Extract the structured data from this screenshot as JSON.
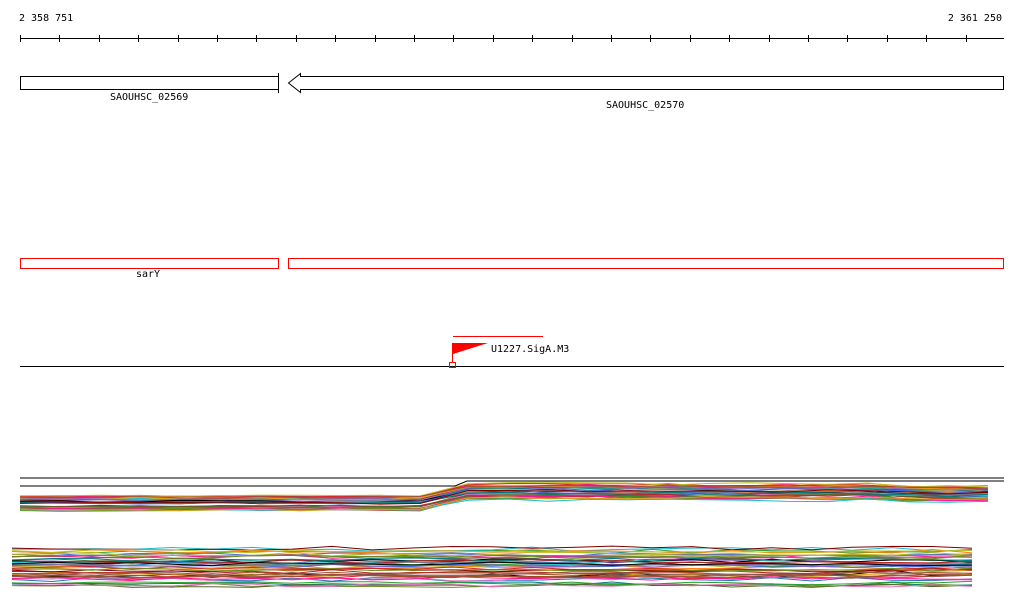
{
  "ruler": {
    "start_label": "2 358 751",
    "end_label": "2 361 250"
  },
  "genes": [
    {
      "name": "SAOUHSC_02569",
      "strand": "+"
    },
    {
      "name": "SAOUHSC_02570",
      "strand": "-"
    }
  ],
  "features": [
    {
      "name": "sarY",
      "color": "#ff0000"
    },
    {
      "name": "",
      "color": "#ff0000"
    }
  ],
  "site": {
    "name": "U1227.SigA.M3",
    "color": "#ff0000"
  },
  "colors": {
    "axis": "#000000",
    "gene_outline": "#000000",
    "feature_outline": "#ff0000"
  }
}
